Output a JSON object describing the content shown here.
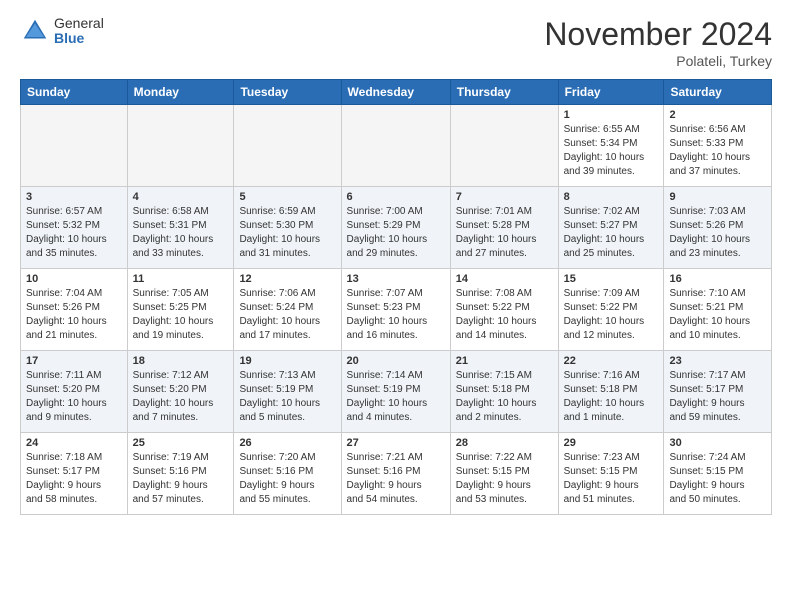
{
  "logo": {
    "general": "General",
    "blue": "Blue"
  },
  "title": "November 2024",
  "subtitle": "Polateli, Turkey",
  "days_header": [
    "Sunday",
    "Monday",
    "Tuesday",
    "Wednesday",
    "Thursday",
    "Friday",
    "Saturday"
  ],
  "weeks": [
    [
      {
        "day": "",
        "info": ""
      },
      {
        "day": "",
        "info": ""
      },
      {
        "day": "",
        "info": ""
      },
      {
        "day": "",
        "info": ""
      },
      {
        "day": "",
        "info": ""
      },
      {
        "day": "1",
        "info": "Sunrise: 6:55 AM\nSunset: 5:34 PM\nDaylight: 10 hours\nand 39 minutes."
      },
      {
        "day": "2",
        "info": "Sunrise: 6:56 AM\nSunset: 5:33 PM\nDaylight: 10 hours\nand 37 minutes."
      }
    ],
    [
      {
        "day": "3",
        "info": "Sunrise: 6:57 AM\nSunset: 5:32 PM\nDaylight: 10 hours\nand 35 minutes."
      },
      {
        "day": "4",
        "info": "Sunrise: 6:58 AM\nSunset: 5:31 PM\nDaylight: 10 hours\nand 33 minutes."
      },
      {
        "day": "5",
        "info": "Sunrise: 6:59 AM\nSunset: 5:30 PM\nDaylight: 10 hours\nand 31 minutes."
      },
      {
        "day": "6",
        "info": "Sunrise: 7:00 AM\nSunset: 5:29 PM\nDaylight: 10 hours\nand 29 minutes."
      },
      {
        "day": "7",
        "info": "Sunrise: 7:01 AM\nSunset: 5:28 PM\nDaylight: 10 hours\nand 27 minutes."
      },
      {
        "day": "8",
        "info": "Sunrise: 7:02 AM\nSunset: 5:27 PM\nDaylight: 10 hours\nand 25 minutes."
      },
      {
        "day": "9",
        "info": "Sunrise: 7:03 AM\nSunset: 5:26 PM\nDaylight: 10 hours\nand 23 minutes."
      }
    ],
    [
      {
        "day": "10",
        "info": "Sunrise: 7:04 AM\nSunset: 5:26 PM\nDaylight: 10 hours\nand 21 minutes."
      },
      {
        "day": "11",
        "info": "Sunrise: 7:05 AM\nSunset: 5:25 PM\nDaylight: 10 hours\nand 19 minutes."
      },
      {
        "day": "12",
        "info": "Sunrise: 7:06 AM\nSunset: 5:24 PM\nDaylight: 10 hours\nand 17 minutes."
      },
      {
        "day": "13",
        "info": "Sunrise: 7:07 AM\nSunset: 5:23 PM\nDaylight: 10 hours\nand 16 minutes."
      },
      {
        "day": "14",
        "info": "Sunrise: 7:08 AM\nSunset: 5:22 PM\nDaylight: 10 hours\nand 14 minutes."
      },
      {
        "day": "15",
        "info": "Sunrise: 7:09 AM\nSunset: 5:22 PM\nDaylight: 10 hours\nand 12 minutes."
      },
      {
        "day": "16",
        "info": "Sunrise: 7:10 AM\nSunset: 5:21 PM\nDaylight: 10 hours\nand 10 minutes."
      }
    ],
    [
      {
        "day": "17",
        "info": "Sunrise: 7:11 AM\nSunset: 5:20 PM\nDaylight: 10 hours\nand 9 minutes."
      },
      {
        "day": "18",
        "info": "Sunrise: 7:12 AM\nSunset: 5:20 PM\nDaylight: 10 hours\nand 7 minutes."
      },
      {
        "day": "19",
        "info": "Sunrise: 7:13 AM\nSunset: 5:19 PM\nDaylight: 10 hours\nand 5 minutes."
      },
      {
        "day": "20",
        "info": "Sunrise: 7:14 AM\nSunset: 5:19 PM\nDaylight: 10 hours\nand 4 minutes."
      },
      {
        "day": "21",
        "info": "Sunrise: 7:15 AM\nSunset: 5:18 PM\nDaylight: 10 hours\nand 2 minutes."
      },
      {
        "day": "22",
        "info": "Sunrise: 7:16 AM\nSunset: 5:18 PM\nDaylight: 10 hours\nand 1 minute."
      },
      {
        "day": "23",
        "info": "Sunrise: 7:17 AM\nSunset: 5:17 PM\nDaylight: 9 hours\nand 59 minutes."
      }
    ],
    [
      {
        "day": "24",
        "info": "Sunrise: 7:18 AM\nSunset: 5:17 PM\nDaylight: 9 hours\nand 58 minutes."
      },
      {
        "day": "25",
        "info": "Sunrise: 7:19 AM\nSunset: 5:16 PM\nDaylight: 9 hours\nand 57 minutes."
      },
      {
        "day": "26",
        "info": "Sunrise: 7:20 AM\nSunset: 5:16 PM\nDaylight: 9 hours\nand 55 minutes."
      },
      {
        "day": "27",
        "info": "Sunrise: 7:21 AM\nSunset: 5:16 PM\nDaylight: 9 hours\nand 54 minutes."
      },
      {
        "day": "28",
        "info": "Sunrise: 7:22 AM\nSunset: 5:15 PM\nDaylight: 9 hours\nand 53 minutes."
      },
      {
        "day": "29",
        "info": "Sunrise: 7:23 AM\nSunset: 5:15 PM\nDaylight: 9 hours\nand 51 minutes."
      },
      {
        "day": "30",
        "info": "Sunrise: 7:24 AM\nSunset: 5:15 PM\nDaylight: 9 hours\nand 50 minutes."
      }
    ]
  ]
}
